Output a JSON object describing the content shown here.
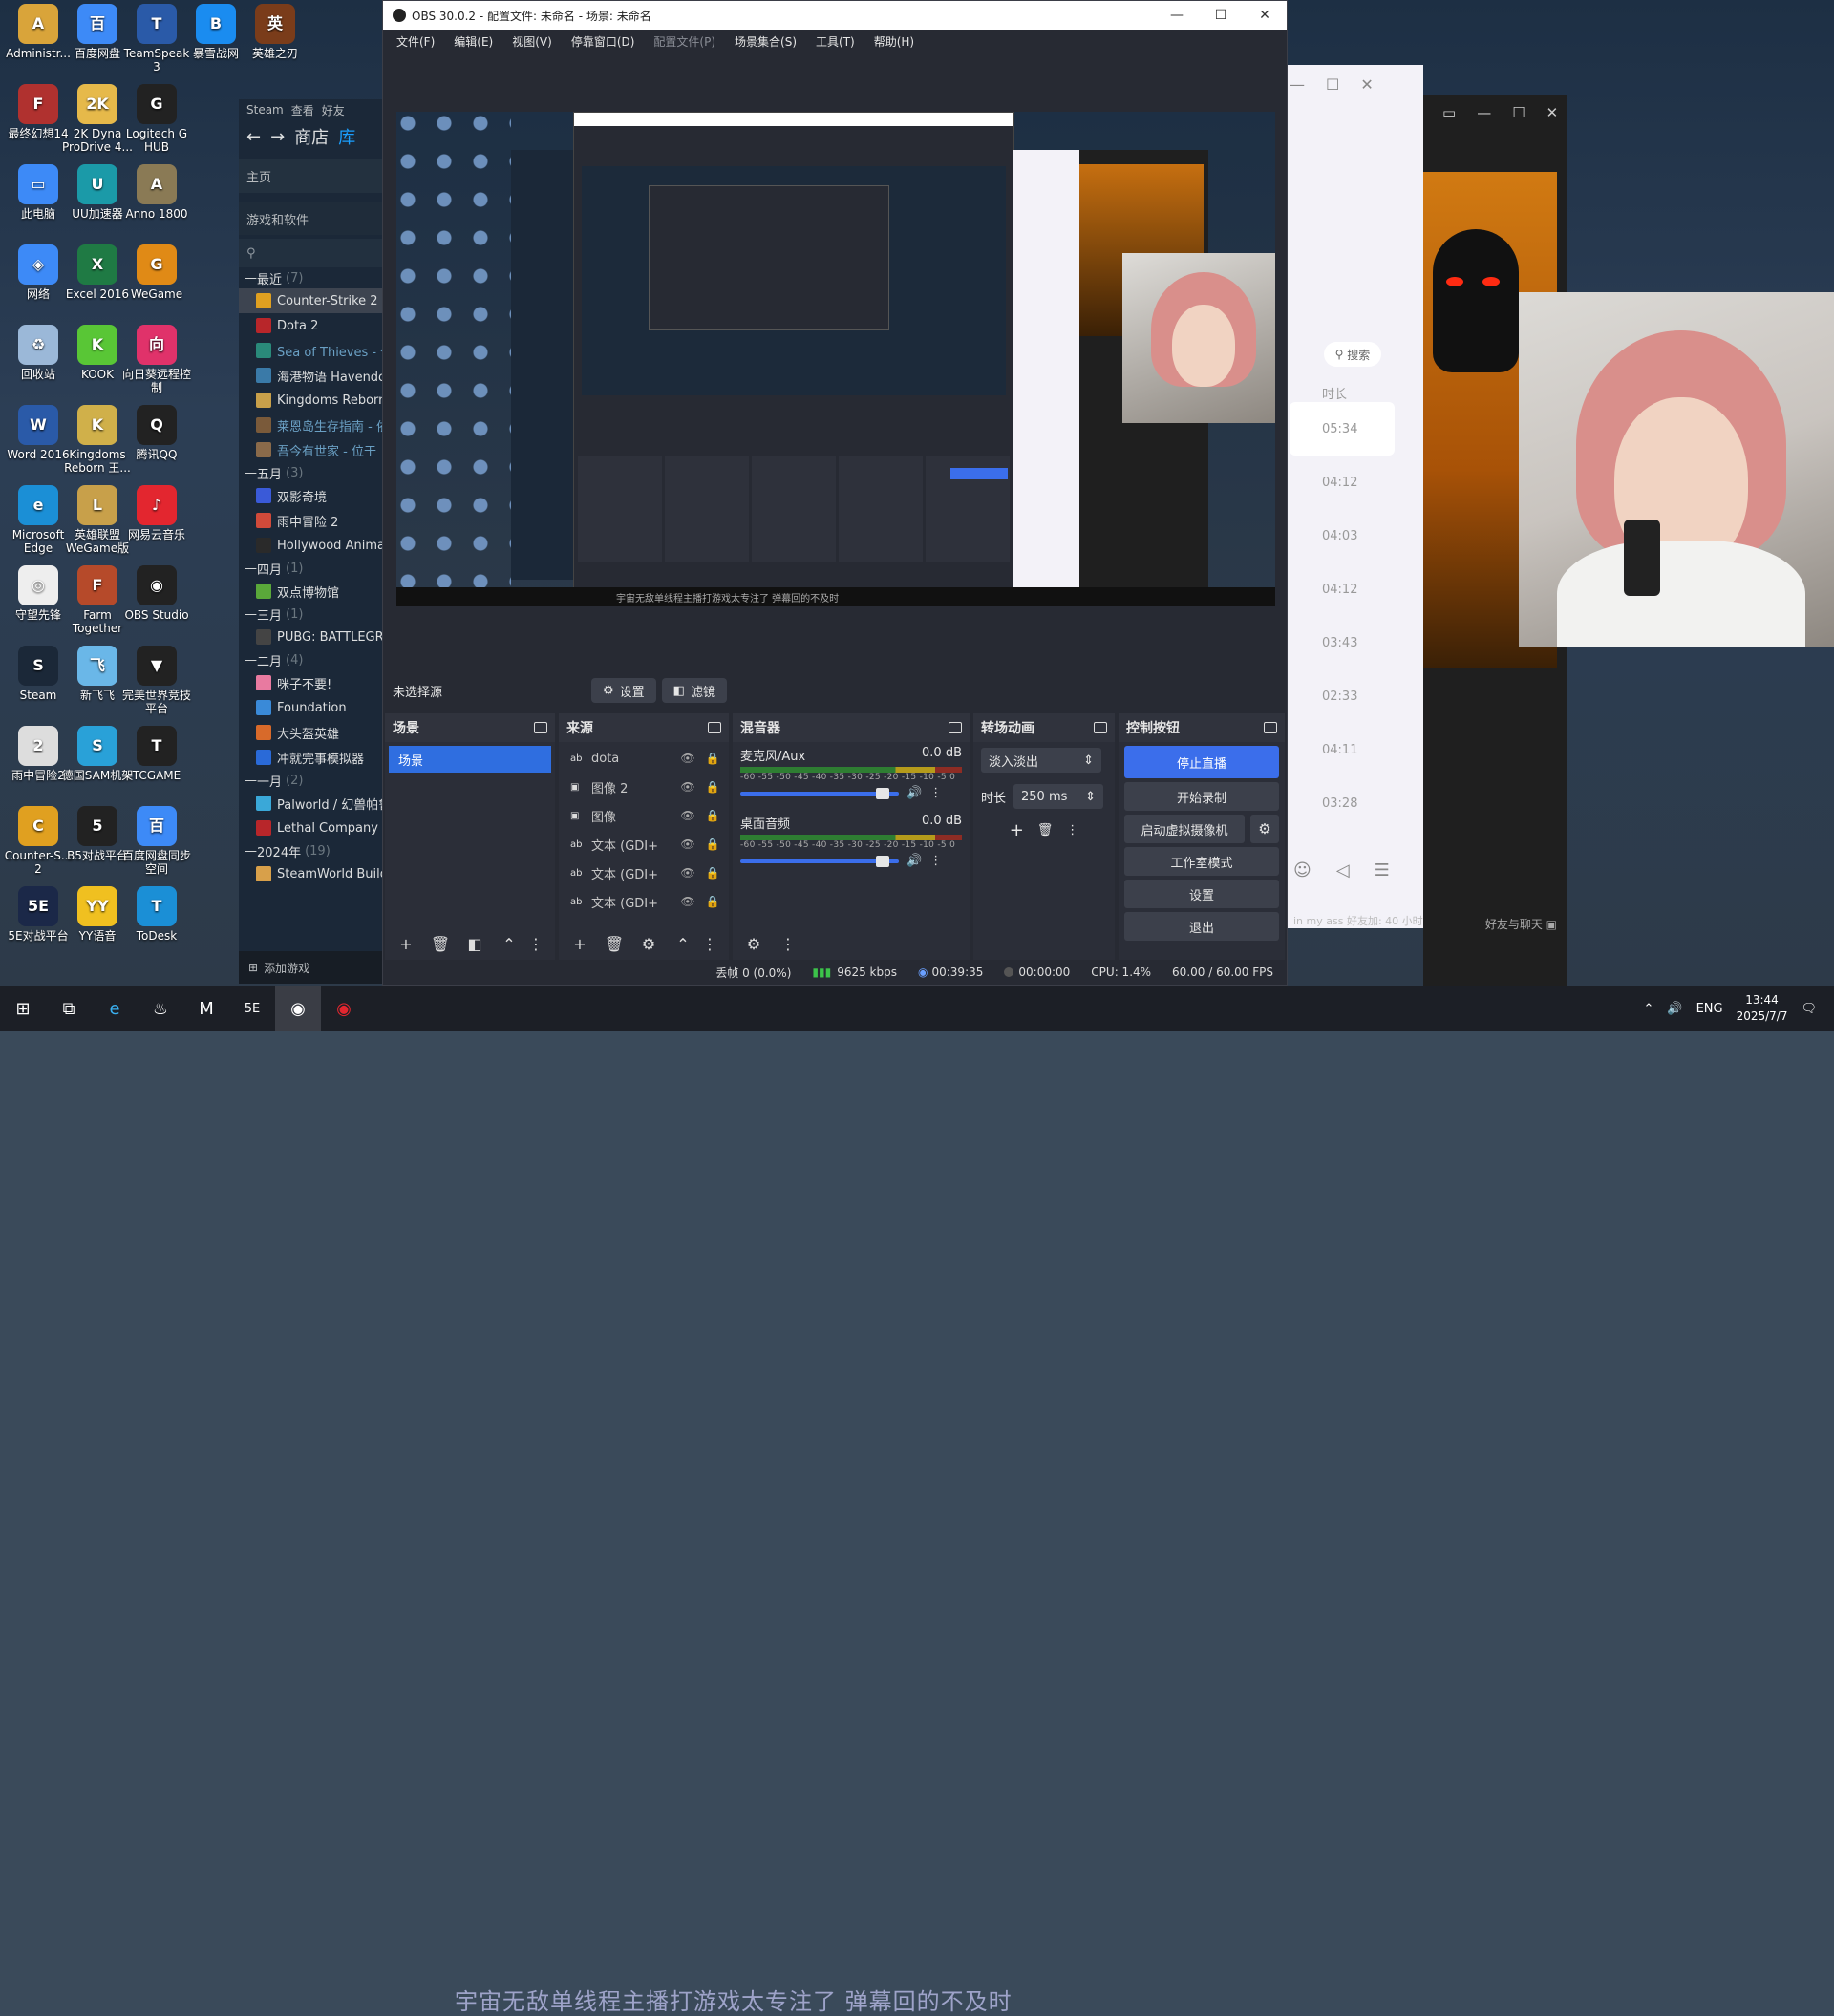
{
  "desktop": {
    "icons": [
      {
        "label": "Administr...",
        "color": "#d9a43a",
        "glyph": "A",
        "col": 0,
        "row": 0
      },
      {
        "label": "百度网盘",
        "color": "#3d8af7",
        "glyph": "百",
        "col": 1,
        "row": 0
      },
      {
        "label": "TeamSpeak 3",
        "color": "#2a5aa8",
        "glyph": "T",
        "col": 2,
        "row": 0
      },
      {
        "label": "暴雪战网",
        "color": "#1a8cf0",
        "glyph": "B",
        "col": 3,
        "row": 0
      },
      {
        "label": "英雄之刃",
        "color": "#7a3c1a",
        "glyph": "英",
        "col": 4,
        "row": 0
      },
      {
        "label": "最终幻想14",
        "color": "#b0312f",
        "glyph": "F",
        "col": 0,
        "row": 1
      },
      {
        "label": "2K Dyna ProDrive 4...",
        "color": "#e6b94a",
        "glyph": "2K",
        "col": 1,
        "row": 1
      },
      {
        "label": "Logitech G HUB",
        "color": "#222",
        "glyph": "G",
        "col": 2,
        "row": 1
      },
      {
        "label": "此电脑",
        "color": "#3d8af7",
        "glyph": "▭",
        "col": 0,
        "row": 2
      },
      {
        "label": "UU加速器",
        "color": "#1b9aa8",
        "glyph": "U",
        "col": 1,
        "row": 2
      },
      {
        "label": "Anno 1800",
        "color": "#8a7a55",
        "glyph": "A",
        "col": 2,
        "row": 2
      },
      {
        "label": "网络",
        "color": "#3d8af7",
        "glyph": "◈",
        "col": 0,
        "row": 3
      },
      {
        "label": "Excel 2016",
        "color": "#1f7a44",
        "glyph": "X",
        "col": 1,
        "row": 3
      },
      {
        "label": "WeGame",
        "color": "#e08a16",
        "glyph": "G",
        "col": 2,
        "row": 3
      },
      {
        "label": "回收站",
        "color": "#9bb8d8",
        "glyph": "♻",
        "col": 0,
        "row": 4
      },
      {
        "label": "KOOK",
        "color": "#59c636",
        "glyph": "K",
        "col": 1,
        "row": 4
      },
      {
        "label": "向日葵远程控制",
        "color": "#e0326a",
        "glyph": "向",
        "col": 2,
        "row": 4
      },
      {
        "label": "Word 2016",
        "color": "#2a5aa8",
        "glyph": "W",
        "col": 0,
        "row": 5
      },
      {
        "label": "Kingdoms Reborn 王...",
        "color": "#d0b04a",
        "glyph": "K",
        "col": 1,
        "row": 5
      },
      {
        "label": "腾讯QQ",
        "color": "#222",
        "glyph": "Q",
        "col": 2,
        "row": 5
      },
      {
        "label": "Microsoft Edge",
        "color": "#1b8fd6",
        "glyph": "e",
        "col": 0,
        "row": 6
      },
      {
        "label": "英雄联盟 WeGame版",
        "color": "#c8a04a",
        "glyph": "L",
        "col": 1,
        "row": 6
      },
      {
        "label": "网易云音乐",
        "color": "#e3262f",
        "glyph": "♪",
        "col": 2,
        "row": 6
      },
      {
        "label": "守望先锋",
        "color": "#eee",
        "glyph": "◎",
        "col": 0,
        "row": 7
      },
      {
        "label": "Farm Together",
        "color": "#b64a2a",
        "glyph": "F",
        "col": 1,
        "row": 7
      },
      {
        "label": "OBS Studio",
        "color": "#222",
        "glyph": "◉",
        "col": 2,
        "row": 7
      },
      {
        "label": "Steam",
        "color": "#1b2838",
        "glyph": "S",
        "col": 0,
        "row": 8
      },
      {
        "label": "新飞飞",
        "color": "#6ab7e8",
        "glyph": "飞",
        "col": 1,
        "row": 8
      },
      {
        "label": "完美世界竞技平台",
        "color": "#222",
        "glyph": "▼",
        "col": 2,
        "row": 8
      },
      {
        "label": "雨中冒险2",
        "color": "#ddd",
        "glyph": "2",
        "col": 0,
        "row": 9
      },
      {
        "label": "德国SAM机架",
        "color": "#29a1d8",
        "glyph": "S",
        "col": 1,
        "row": 9
      },
      {
        "label": "TCGAME",
        "color": "#222",
        "glyph": "T",
        "col": 2,
        "row": 9
      },
      {
        "label": "Counter-S... 2",
        "color": "#e0a020",
        "glyph": "C",
        "col": 0,
        "row": 10
      },
      {
        "label": "B5对战平台",
        "color": "#222",
        "glyph": "5",
        "col": 1,
        "row": 10
      },
      {
        "label": "百度网盘同步空间",
        "color": "#3d8af7",
        "glyph": "百",
        "col": 2,
        "row": 10
      },
      {
        "label": "5E对战平台",
        "color": "#1b2848",
        "glyph": "5E",
        "col": 0,
        "row": 11
      },
      {
        "label": "YY语音",
        "color": "#f0c020",
        "glyph": "YY",
        "col": 1,
        "row": 11
      },
      {
        "label": "ToDesk",
        "color": "#1b8fd6",
        "glyph": "T",
        "col": 2,
        "row": 11
      }
    ]
  },
  "steam": {
    "top_items": [
      "Steam",
      "查看",
      "好友"
    ],
    "nav": {
      "store": "商店",
      "library": "库"
    },
    "home": "主页",
    "filter": "游戏和软件",
    "search_icon": "search-icon",
    "groups": [
      {
        "label": "最近",
        "count": "(7)",
        "games": [
          {
            "name": "Counter-Strike 2",
            "color": "#e0a020",
            "selected": true,
            "dim": false
          },
          {
            "name": "Dota 2",
            "color": "#b8262a",
            "selected": false,
            "dim": false
          },
          {
            "name": "Sea of Thieves - 依",
            "color": "#2a8a7a",
            "selected": false,
            "dim": true
          },
          {
            "name": "海港物语 Havendo",
            "color": "#3a7aa8",
            "selected": false,
            "dim": false
          },
          {
            "name": "Kingdoms Reborn",
            "color": "#c8a04a",
            "selected": false,
            "dim": false
          },
          {
            "name": "莱恩岛生存指南 - 依",
            "color": "#7a5a3a",
            "selected": false,
            "dim": true
          },
          {
            "name": "吾今有世家 - 位于",
            "color": "#8a6a4a",
            "selected": false,
            "dim": true
          }
        ]
      },
      {
        "label": "五月",
        "count": "(3)",
        "games": [
          {
            "name": "双影奇境",
            "color": "#3a5ad8",
            "selected": false,
            "dim": false
          },
          {
            "name": "雨中冒险 2",
            "color": "#d04a3a",
            "selected": false,
            "dim": false
          },
          {
            "name": "Hollywood Animal",
            "color": "#2a2a2a",
            "selected": false,
            "dim": false
          }
        ]
      },
      {
        "label": "四月",
        "count": "(1)",
        "games": [
          {
            "name": "双点博物馆",
            "color": "#5aa83a",
            "selected": false,
            "dim": false
          }
        ]
      },
      {
        "label": "三月",
        "count": "(1)",
        "games": [
          {
            "name": "PUBG: BATTLEGRO",
            "color": "#444",
            "selected": false,
            "dim": false
          }
        ]
      },
      {
        "label": "二月",
        "count": "(4)",
        "games": [
          {
            "name": "咪子不要!",
            "color": "#e87aa0",
            "selected": false,
            "dim": false
          },
          {
            "name": "Foundation",
            "color": "#3a8ad8",
            "selected": false,
            "dim": false
          },
          {
            "name": "大头盔英雄",
            "color": "#d86a2a",
            "selected": false,
            "dim": false
          },
          {
            "name": "冲就完事模拟器",
            "color": "#2a6ad8",
            "selected": false,
            "dim": false
          }
        ]
      },
      {
        "label": "一月",
        "count": "(2)",
        "games": [
          {
            "name": "Palworld / 幻兽帕鲁",
            "color": "#3aa8d8",
            "selected": false,
            "dim": false
          },
          {
            "name": "Lethal Company",
            "color": "#b8262a",
            "selected": false,
            "dim": false
          }
        ]
      },
      {
        "label": "2024年",
        "count": "(19)",
        "games": [
          {
            "name": "SteamWorld Build",
            "color": "#d8a04a",
            "selected": false,
            "dim": false
          }
        ]
      }
    ],
    "add_game": "添加游戏"
  },
  "chat_window": {
    "search": "搜索",
    "duration_header": "时长",
    "durations": [
      "05:34",
      "04:12",
      "04:03",
      "04:12",
      "03:43",
      "02:33",
      "04:11",
      "03:28"
    ],
    "footer": "in my ass 好友加: 40 小时"
  },
  "dark_window": {
    "friends_chat": "好友与聊天"
  },
  "obs": {
    "title": "OBS 30.0.2 - 配置文件: 未命名 - 场景: 未命名",
    "menu": [
      {
        "label": "文件(F)",
        "disabled": false
      },
      {
        "label": "编辑(E)",
        "disabled": false
      },
      {
        "label": "视图(V)",
        "disabled": false
      },
      {
        "label": "停靠窗口(D)",
        "disabled": false
      },
      {
        "label": "配置文件(P)",
        "disabled": true
      },
      {
        "label": "场景集合(S)",
        "disabled": false
      },
      {
        "label": "工具(T)",
        "disabled": false
      },
      {
        "label": "帮助(H)",
        "disabled": false
      }
    ],
    "preview_subtitle": "宇宙无敌单线程主播打游戏太专注了 弹幕回的不及时",
    "source_bar": {
      "label": "未选择源",
      "settings": "设置",
      "filters": "滤镜"
    },
    "scenes": {
      "title": "场景",
      "items": [
        "场景"
      ]
    },
    "sources": {
      "title": "来源",
      "items": [
        {
          "type": "ab",
          "name": "dota"
        },
        {
          "type": "img",
          "name": "图像 2"
        },
        {
          "type": "img",
          "name": "图像"
        },
        {
          "type": "ab",
          "name": "文本 (GDI+"
        },
        {
          "type": "ab",
          "name": "文本 (GDI+"
        },
        {
          "type": "ab",
          "name": "文本 (GDI+"
        }
      ]
    },
    "mixer": {
      "title": "混音器",
      "channels": [
        {
          "name": "麦克风/Aux",
          "db": "0.0 dB",
          "ticks": "-60 -55 -50 -45 -40 -35 -30 -25 -20 -15 -10 -5 0",
          "level": 0.9
        },
        {
          "name": "桌面音频",
          "db": "0.0 dB",
          "ticks": "-60 -55 -50 -45 -40 -35 -30 -25 -20 -15 -10 -5 0",
          "level": 0.9
        }
      ]
    },
    "transitions": {
      "title": "转场动画",
      "type": "淡入淡出",
      "duration_label": "时长",
      "duration": "250 ms"
    },
    "controls": {
      "title": "控制按钮",
      "stop_stream": "停止直播",
      "start_record": "开始录制",
      "virtual_cam": "启动虚拟摄像机",
      "studio_mode": "工作室模式",
      "settings": "设置",
      "exit": "退出"
    },
    "status": {
      "dropped": "丢帧 0 (0.0%)",
      "bitrate": "9625 kbps",
      "live_time": "00:39:35",
      "rec_time": "00:00:00",
      "cpu": "CPU: 1.4%",
      "fps": "60.00 / 60.00 FPS"
    }
  },
  "taskbar": {
    "subtitle": "宇宙无敌单线程主播打游戏太专注了 弹幕回的不及时",
    "lang": "ENG",
    "time": "13:44",
    "date": "2025/7/7"
  }
}
